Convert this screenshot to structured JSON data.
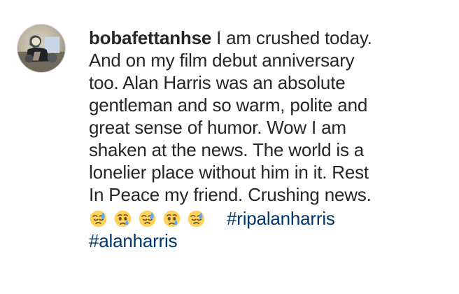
{
  "comment": {
    "username": "bobafettanhse",
    "text_lines": [
      " I am crushed today.",
      "And on my film debut anniversary",
      "too. Alan Harris was an absolute",
      "gentleman and so warm, polite and",
      "great sense of humor. Wow I am",
      "shaken at the news. The world is a",
      "lonelier place without him in it. Rest",
      "In Peace my friend. Crushing news."
    ],
    "emojis": [
      "downcast-face-with-sweat",
      "crying-face",
      "downcast-face-with-sweat",
      "crying-face",
      "downcast-face-with-sweat"
    ],
    "hashtags": [
      "#ripalanharris",
      "#alanharris"
    ]
  },
  "colors": {
    "text": "#262626",
    "hashtag": "#00376b",
    "emoji_face": "#fdd35a",
    "emoji_sweat": "#5aa7ff"
  }
}
